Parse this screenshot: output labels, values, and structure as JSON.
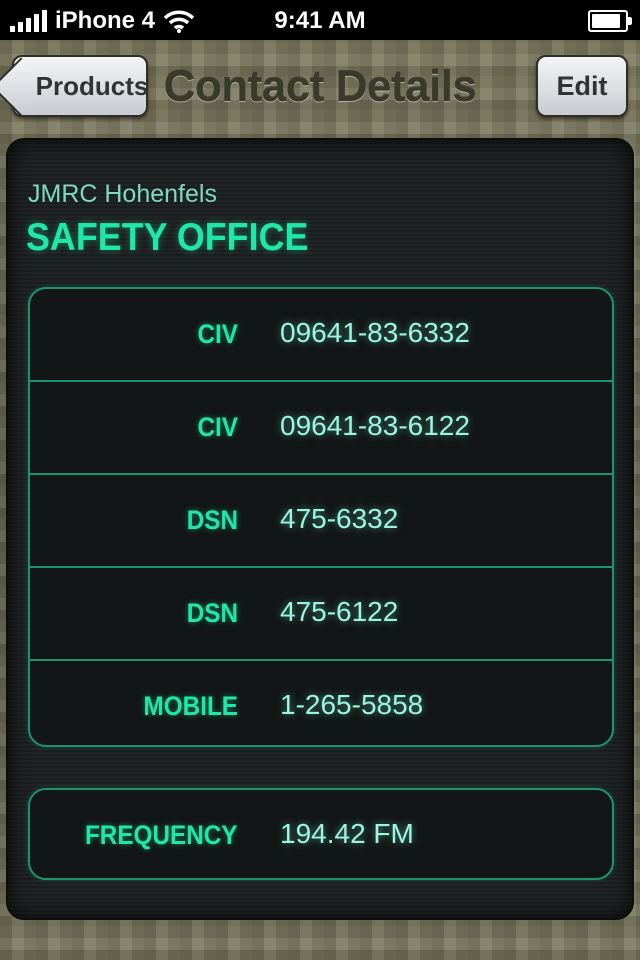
{
  "status_bar": {
    "carrier": "iPhone 4",
    "time": "9:41 AM"
  },
  "nav": {
    "title": "Contact Details",
    "back_label": "Products",
    "edit_label": "Edit"
  },
  "contact": {
    "organization": "JMRC Hohenfels",
    "office": "SAFETY OFFICE",
    "phones": [
      {
        "label": "CIV",
        "value": "09641-83-6332"
      },
      {
        "label": "CIV",
        "value": "09641-83-6122"
      },
      {
        "label": "DSN",
        "value": "475-6332"
      },
      {
        "label": "DSN",
        "value": "475-6122"
      },
      {
        "label": "MOBILE",
        "value": "1-265-5858"
      }
    ],
    "frequency": {
      "label": "FREQUENCY",
      "value": "194.42 FM"
    }
  },
  "colors": {
    "accent": "#1fe7a8",
    "value_text": "#9cf5e0",
    "panel": "#1c2020",
    "border": "#1d9173"
  }
}
